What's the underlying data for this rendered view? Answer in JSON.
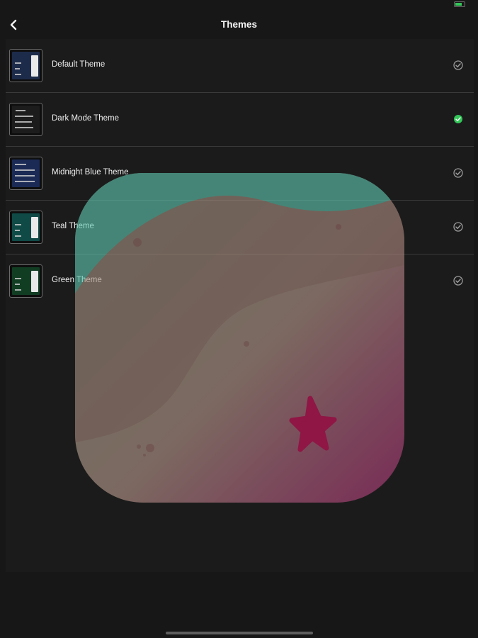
{
  "nav": {
    "title": "Themes",
    "back_icon": "chevron-left-icon"
  },
  "themes": [
    {
      "label": "Default Theme",
      "selected": false,
      "thumb_color": "#1d2b4a",
      "check_color": "#9a9a9a"
    },
    {
      "label": "Dark Mode Theme",
      "selected": true,
      "thumb_color": "#1c1c1c",
      "check_color": "#34c759"
    },
    {
      "label": "Midnight Blue Theme",
      "selected": false,
      "thumb_color": "#1a2a55",
      "check_color": "#9a9a9a"
    },
    {
      "label": "Teal Theme",
      "selected": false,
      "thumb_color": "#0f4a46",
      "check_color": "#9a9a9a"
    },
    {
      "label": "Green Theme",
      "selected": false,
      "thumb_color": "#113d23",
      "check_color": "#9a9a9a"
    }
  ],
  "colors": {
    "background": "#171717",
    "list_background": "#1b1b1b",
    "selected_check": "#34c759",
    "unselected_check": "#9a9a9a",
    "overlay_teal": "#5fc7b0",
    "overlay_sand": "#b8948a",
    "overlay_star": "#d6135f"
  },
  "overlay": {
    "icon": "starfish-beach-app-icon"
  }
}
